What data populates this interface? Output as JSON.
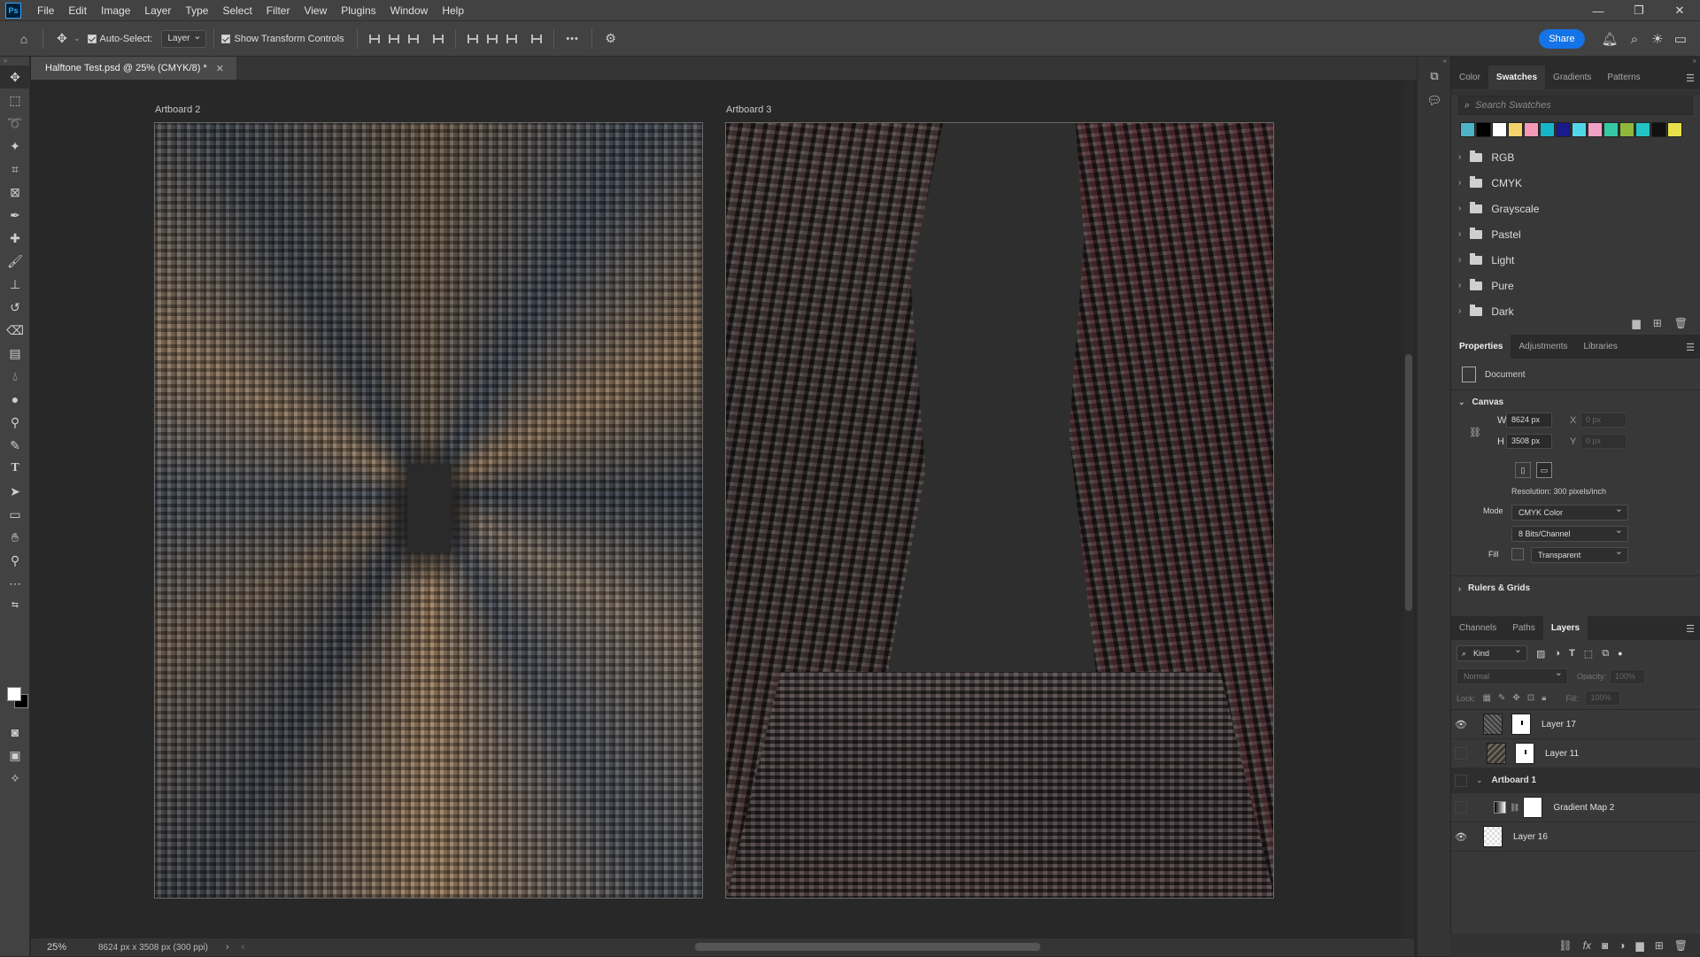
{
  "app": {
    "logo": "Ps"
  },
  "menu": [
    "File",
    "Edit",
    "Image",
    "Layer",
    "Type",
    "Select",
    "Filter",
    "View",
    "Plugins",
    "Window",
    "Help"
  ],
  "window_controls": {
    "minimize": "—",
    "restore": "❐",
    "close": "✕"
  },
  "options_bar": {
    "auto_select_label": "Auto-Select:",
    "auto_select_target": "Layer",
    "show_transform_label": "Show Transform Controls",
    "more_label": "•••",
    "share_label": "Share"
  },
  "document": {
    "tab_title": "Halftone Test.psd @ 25% (CMYK/8) *",
    "artboards": [
      {
        "label": "Artboard 2"
      },
      {
        "label": "Artboard 3"
      }
    ]
  },
  "status": {
    "zoom": "25%",
    "doc_info": "8624 px x 3508 px (300 ppi)"
  },
  "swatches_panel": {
    "tabs": [
      "Color",
      "Swatches",
      "Gradients",
      "Patterns"
    ],
    "active_tab": "Swatches",
    "search_placeholder": "Search Swatches",
    "recent_colors": [
      "#4fb3c8",
      "#000000",
      "#ffffff",
      "#f5d36a",
      "#f49ab8",
      "#18b5c9",
      "#1a1a8c",
      "#52d7e8",
      "#f3a0c5",
      "#35c9a5",
      "#8fb83a",
      "#22c4c4",
      "#111111",
      "#e6e14a"
    ],
    "folders": [
      "RGB",
      "CMYK",
      "Grayscale",
      "Pastel",
      "Light",
      "Pure",
      "Dark"
    ]
  },
  "properties_panel": {
    "tabs": [
      "Properties",
      "Adjustments",
      "Libraries"
    ],
    "active_tab": "Properties",
    "doc_label": "Document",
    "canvas_section": "Canvas",
    "w_label": "W",
    "w_value": "8624 px",
    "h_label": "H",
    "h_value": "3508 px",
    "x_label": "X",
    "x_value": "0 px",
    "y_label": "Y",
    "y_value": "0 px",
    "resolution": "Resolution: 300 pixels/inch",
    "mode_label": "Mode",
    "mode_value": "CMYK Color",
    "bits_value": "8 Bits/Channel",
    "fill_label": "Fill",
    "fill_value": "Transparent",
    "rulers_section": "Rulers & Grids"
  },
  "layers_panel": {
    "tabs": [
      "Channels",
      "Paths",
      "Layers"
    ],
    "active_tab": "Layers",
    "filter_kind": "Kind",
    "blend_mode": "Normal",
    "opacity_label": "Opacity:",
    "opacity_value": "100%",
    "lock_label": "Lock:",
    "fill_label": "Fill:",
    "fill_value": "100%",
    "layers": [
      {
        "name": "Layer 17",
        "visible": true
      },
      {
        "name": "Layer 11",
        "visible": false
      },
      {
        "name": "Artboard 1",
        "group": true
      },
      {
        "name": "Gradient Map 2",
        "visible": false
      },
      {
        "name": "Layer 16",
        "visible": true
      }
    ]
  }
}
